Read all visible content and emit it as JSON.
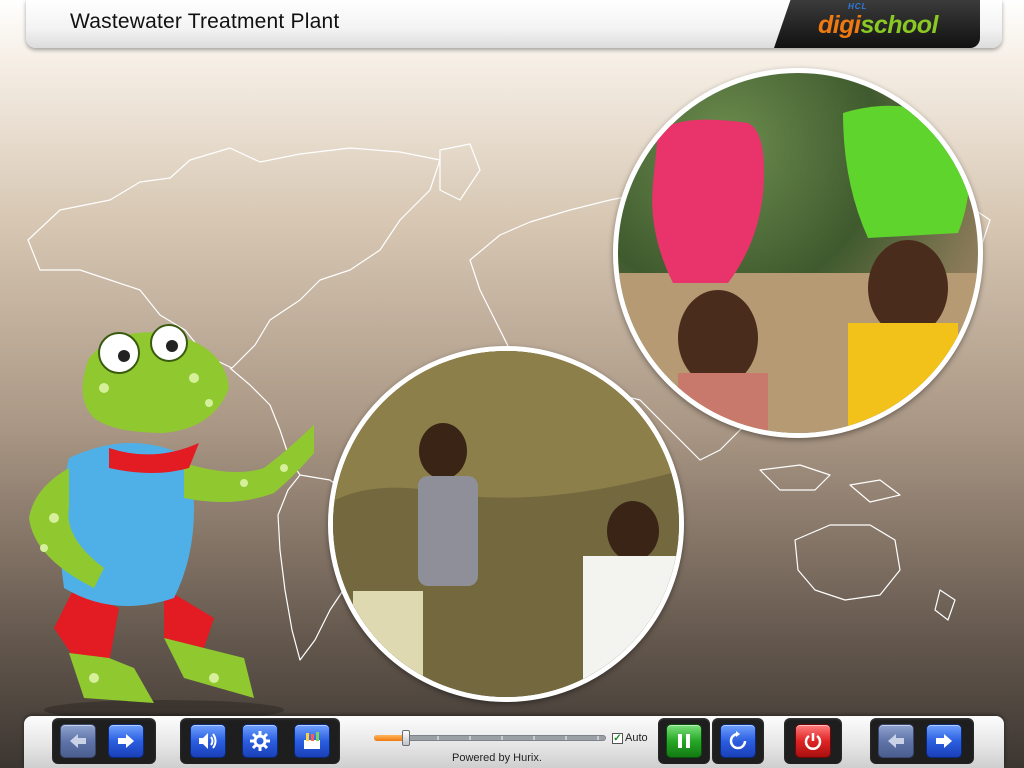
{
  "header": {
    "title": "Wastewater Treatment Plant",
    "logo": {
      "small": "HCL",
      "word_a": "digi",
      "word_b": "school"
    }
  },
  "toolbar": {
    "nav_left": {
      "back_icon": "left-arrow-icon",
      "forward_icon": "right-arrow-icon"
    },
    "tools": {
      "audio_icon": "speaker-icon",
      "settings_icon": "gear-icon",
      "tools_icon": "stationery-icon"
    },
    "progress": {
      "fraction": 0.14
    },
    "auto_label": "Auto",
    "auto_checked": true,
    "powered_by": "Powered by Hurix.",
    "pause_icon": "pause-icon",
    "replay_icon": "replay-icon",
    "exit_icon": "power-icon",
    "nav_right": {
      "back_icon": "left-arrow-icon",
      "forward_icon": "right-arrow-icon"
    }
  },
  "colors": {
    "accent_orange": "#f07a10",
    "accent_green": "#8ac924",
    "button_blue": "#2b5fe0",
    "pause_green": "#26a826",
    "exit_red": "#e02424"
  }
}
